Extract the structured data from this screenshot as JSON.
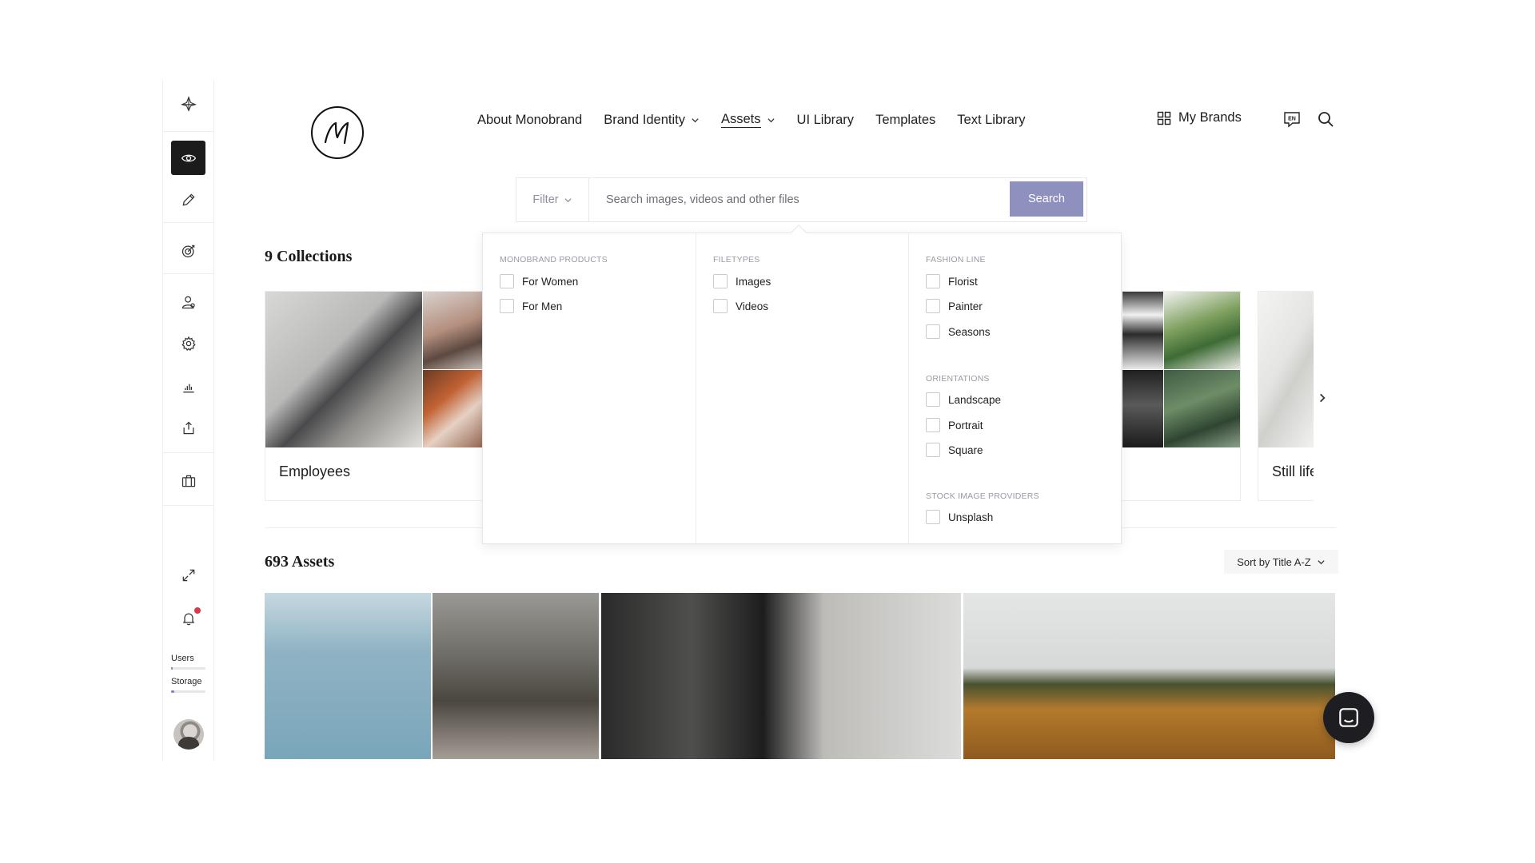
{
  "nav": {
    "items": [
      {
        "label": "About Monobrand",
        "dropdown": false
      },
      {
        "label": "Brand Identity",
        "dropdown": true
      },
      {
        "label": "Assets",
        "dropdown": true,
        "active": true
      },
      {
        "label": "UI Library",
        "dropdown": false
      },
      {
        "label": "Templates",
        "dropdown": false
      },
      {
        "label": "Text Library",
        "dropdown": false
      }
    ],
    "my_brands": "My Brands",
    "language_badge": "EN"
  },
  "search": {
    "filter_label": "Filter",
    "placeholder": "Search images, videos and other files",
    "button_label": "Search"
  },
  "filters": {
    "monobrand_products": {
      "title": "MONOBRAND PRODUCTS",
      "options": [
        "For Women",
        "For Men"
      ]
    },
    "filetypes": {
      "title": "FILETYPES",
      "options": [
        "Images",
        "Videos"
      ]
    },
    "fashion_line": {
      "title": "FASHION LINE",
      "options": [
        "Florist",
        "Painter",
        "Seasons"
      ]
    },
    "orientations": {
      "title": "ORIENTATIONS",
      "options": [
        "Landscape",
        "Portrait",
        "Square"
      ]
    },
    "stock_image_providers": {
      "title": "STOCK IMAGE PROVIDERS",
      "options": [
        "Unsplash"
      ]
    }
  },
  "collections": {
    "title": "9 Collections",
    "cards": [
      {
        "label": "Employees"
      },
      {
        "label": ""
      },
      {
        "label": "Still life"
      }
    ]
  },
  "assets": {
    "title": "693 Assets",
    "sort_label": "Sort by Title A-Z"
  },
  "sidebar": {
    "users_label": "Users",
    "storage_label": "Storage",
    "users_usage": 0.02,
    "storage_usage": 0.1
  },
  "colors": {
    "accent": "#8e90bd",
    "notification": "#e0364a",
    "sidebar_active": "#1b1b1b"
  }
}
